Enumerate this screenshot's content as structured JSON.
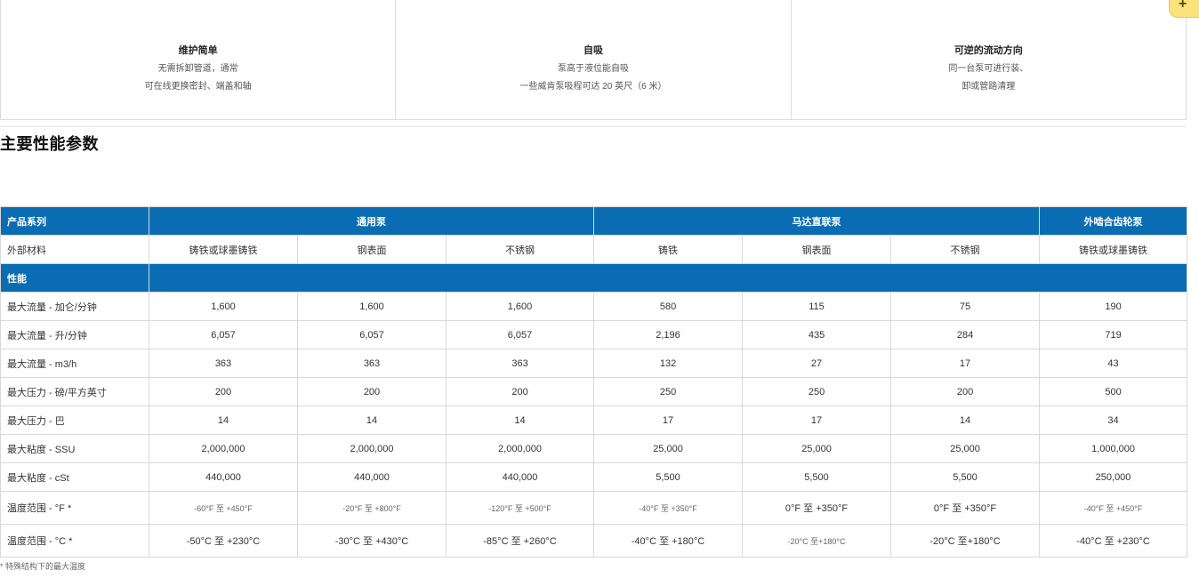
{
  "features": [
    {
      "title": "维护简单",
      "line1": "无需拆卸管道，通常",
      "line2": "可在线更换密封、端盖和轴"
    },
    {
      "title": "自吸",
      "line1": "泵高于液位能自吸",
      "line2": "一些威肯泵吸程可达 20 英尺（6 米）"
    },
    {
      "title": "可逆的流动方向",
      "line1": "同一台泵可进行装、",
      "line2": "卸或管路清理"
    }
  ],
  "corner_button": {
    "label": "+"
  },
  "section_title": "主要性能参数",
  "table": {
    "header": {
      "label": "产品系列",
      "groups": [
        "通用泵",
        "马达直联泵",
        "外啮合齿轮泵"
      ]
    },
    "materials": {
      "label": "外部材料",
      "values": [
        "铸铁或球墨铸铁",
        "钢表面",
        "不锈钢",
        "铸铁",
        "钢表面",
        "不锈钢",
        "铸铁或球墨铸铁"
      ]
    },
    "performance_label": "性能",
    "rows": [
      {
        "label": "最大流量 - 加仑/分钟",
        "values": [
          "1,600",
          "1,600",
          "1,600",
          "580",
          "115",
          "75",
          "190"
        ]
      },
      {
        "label": "最大流量 - 升/分钟",
        "values": [
          "6,057",
          "6,057",
          "6,057",
          "2,196",
          "435",
          "284",
          "719"
        ]
      },
      {
        "label": "最大流量 - m3/h",
        "values": [
          "363",
          "363",
          "363",
          "132",
          "27",
          "17",
          "43"
        ]
      },
      {
        "label": "最大压力 - 磅/平方英寸",
        "values": [
          "200",
          "200",
          "200",
          "250",
          "250",
          "200",
          "500"
        ]
      },
      {
        "label": "最大压力 - 巴",
        "values": [
          "14",
          "14",
          "14",
          "17",
          "17",
          "14",
          "34"
        ]
      },
      {
        "label": "最大粘度 - SSU",
        "values": [
          "2,000,000",
          "2,000,000",
          "2,000,000",
          "25,000",
          "25,000",
          "25,000",
          "1,000,000"
        ]
      },
      {
        "label": "最大粘度 - cSt",
        "values": [
          "440,000",
          "440,000",
          "440,000",
          "5,500",
          "5,500",
          "5,500",
          "250,000"
        ]
      },
      {
        "label": "温度范围 - °F *",
        "values": [
          "-60°F 至 +450°F",
          "-20°F 至 +800°F",
          "-120°F 至 +500°F",
          "-40°F 至 +350°F",
          "0°F 至 +350°F",
          "0°F 至 +350°F",
          "-40°F 至 +450°F"
        ]
      },
      {
        "label": "温度范围 - °C *",
        "values": [
          "-50°C 至 +230°C",
          "-30°C 至 +430°C",
          "-85°C 至 +260°C",
          "-40°C 至 +180°C",
          "-20°C 至+180°C",
          "-20°C 至+180°C",
          "-40°C 至 +230°C"
        ]
      }
    ]
  },
  "footnote": "* 特殊结构下的最大温度"
}
